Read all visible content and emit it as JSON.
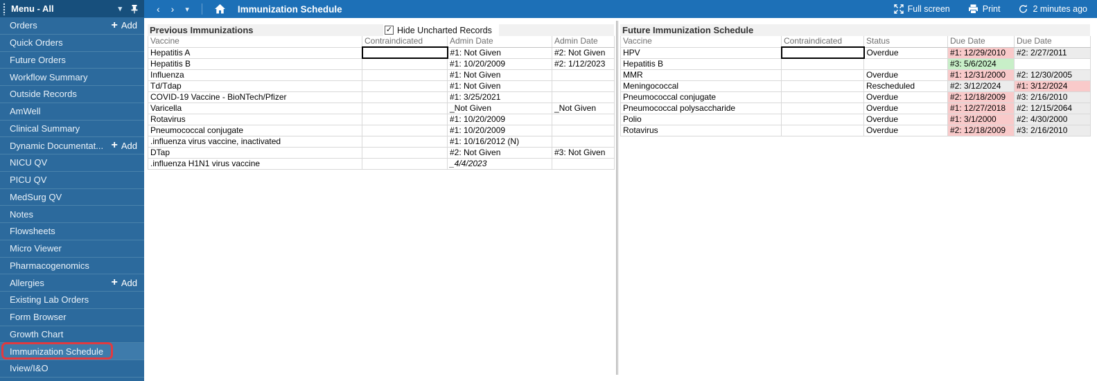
{
  "top_bar": {
    "title": "Immunization Schedule",
    "back_icon": "‹",
    "forward_icon": "›",
    "dropdown_icon": "▾",
    "actions": {
      "full_screen": "Full screen",
      "print": "Print",
      "refresh": "2 minutes ago"
    }
  },
  "sidebar": {
    "header": {
      "title": "Menu - All",
      "dropdown_icon": "▾"
    },
    "add_label": "Add",
    "plus_icon": "+",
    "items": [
      {
        "label": "Orders",
        "add": true
      },
      {
        "label": "Quick Orders"
      },
      {
        "label": "Future Orders"
      },
      {
        "label": "Workflow Summary"
      },
      {
        "label": "Outside Records"
      },
      {
        "label": "AmWell"
      },
      {
        "label": "Clinical Summary"
      },
      {
        "label": "Dynamic Documentat...",
        "add": true
      },
      {
        "label": "NICU QV"
      },
      {
        "label": "PICU QV"
      },
      {
        "label": "MedSurg QV"
      },
      {
        "label": "Notes"
      },
      {
        "label": "Flowsheets"
      },
      {
        "label": "Micro Viewer"
      },
      {
        "label": "Pharmacogenomics"
      },
      {
        "label": "Allergies",
        "add": true
      },
      {
        "label": "Existing Lab Orders"
      },
      {
        "label": "Form Browser"
      },
      {
        "label": "Growth Chart"
      },
      {
        "label": "Immunization Schedule",
        "selected": true,
        "annotated": true
      },
      {
        "label": "Iview/I&O"
      }
    ]
  },
  "previous": {
    "title": "Previous Immunizations",
    "filter_checkbox": {
      "label": "Hide Uncharted Records",
      "checked": true,
      "check_icon": "✓"
    },
    "columns": [
      "Vaccine",
      "Contraindicated",
      "Admin Date",
      "Admin Date"
    ],
    "rows": [
      {
        "vaccine": "Hepatitis A",
        "contraindicated": "",
        "focused": true,
        "admin1": "#1: Not Given",
        "admin2": "#2: Not Given"
      },
      {
        "vaccine": "Hepatitis B",
        "contraindicated": "",
        "admin1": "#1: 10/20/2009",
        "admin2": "#2: 1/12/2023"
      },
      {
        "vaccine": "Influenza",
        "contraindicated": "",
        "admin1": "#1: Not Given",
        "admin2": ""
      },
      {
        "vaccine": "Td/Tdap",
        "contraindicated": "",
        "admin1": "#1: Not Given",
        "admin2": ""
      },
      {
        "vaccine": "COVID-19 Vaccine - BioNTech/Pfizer",
        "contraindicated": "",
        "admin1": "#1: 3/25/2021",
        "admin2": ""
      },
      {
        "vaccine": "Varicella",
        "contraindicated": "",
        "admin1": "_Not Given",
        "admin2": "_Not Given"
      },
      {
        "vaccine": "Rotavirus",
        "contraindicated": "",
        "admin1": "#1: 10/20/2009",
        "admin2": ""
      },
      {
        "vaccine": "Pneumococcal conjugate",
        "contraindicated": "",
        "admin1": "#1: 10/20/2009",
        "admin2": ""
      },
      {
        "vaccine": ".influenza virus vaccine, inactivated",
        "contraindicated": "",
        "admin1": "#1: 10/16/2012 (N)",
        "admin2": ""
      },
      {
        "vaccine": "DTap",
        "contraindicated": "",
        "admin1": "#2: Not Given",
        "admin2": "#3: Not Given"
      },
      {
        "vaccine": ".influenza H1N1 virus vaccine",
        "contraindicated": "",
        "admin1": "_4/4/2023",
        "admin1_italic": true,
        "admin2": ""
      }
    ]
  },
  "future": {
    "title": "Future Immunization Schedule",
    "columns": [
      "Vaccine",
      "Contraindicated",
      "Status",
      "Due Date",
      "Due Date"
    ],
    "rows": [
      {
        "vaccine": "HPV",
        "contraindicated": "",
        "focused": true,
        "status": "Overdue",
        "due1": "#1: 12/29/2010",
        "due1_bg": "pink",
        "due2": "#2: 2/27/2011",
        "due2_bg": "gray"
      },
      {
        "vaccine": "Hepatitis B",
        "contraindicated": "",
        "status": "",
        "due1": "#3: 5/6/2024",
        "due1_bg": "green",
        "due2": "",
        "due2_bg": "white"
      },
      {
        "vaccine": "MMR",
        "contraindicated": "",
        "status": "Overdue",
        "due1": "#1: 12/31/2000",
        "due1_bg": "pink",
        "due2": "#2: 12/30/2005",
        "due2_bg": "gray"
      },
      {
        "vaccine": "Meningococcal",
        "contraindicated": "",
        "status": "Rescheduled",
        "due1": "#2: 3/12/2024",
        "due1_bg": "gray",
        "due2": "#1: 3/12/2024",
        "due2_bg": "pink"
      },
      {
        "vaccine": "Pneumococcal conjugate",
        "contraindicated": "",
        "status": "Overdue",
        "due1": "#2: 12/18/2009",
        "due1_bg": "pink",
        "due2": "#3: 2/16/2010",
        "due2_bg": "gray"
      },
      {
        "vaccine": "Pneumococcal polysaccharide",
        "contraindicated": "",
        "status": "Overdue",
        "due1": "#1: 12/27/2018",
        "due1_bg": "pink",
        "due2": "#2: 12/15/2064",
        "due2_bg": "gray"
      },
      {
        "vaccine": "Polio",
        "contraindicated": "",
        "status": "Overdue",
        "due1": "#1: 3/1/2000",
        "due1_bg": "pink",
        "due2": "#2: 4/30/2000",
        "due2_bg": "gray"
      },
      {
        "vaccine": "Rotavirus",
        "contraindicated": "",
        "status": "Overdue",
        "due1": "#2: 12/18/2009",
        "due1_bg": "pink",
        "due2": "#3: 2/16/2010",
        "due2_bg": "gray"
      }
    ]
  },
  "colors": {
    "topbar": "#1d70b7",
    "sidebar": "#2c6a9d",
    "sidebar_header": "#174f7c",
    "sidebar_selected": "#3e7bab",
    "annotation_red": "#e23a3f",
    "overdue_bg": "#f9caca",
    "current_bg": "#c8efc8",
    "neutral_bg": "#ececec"
  }
}
